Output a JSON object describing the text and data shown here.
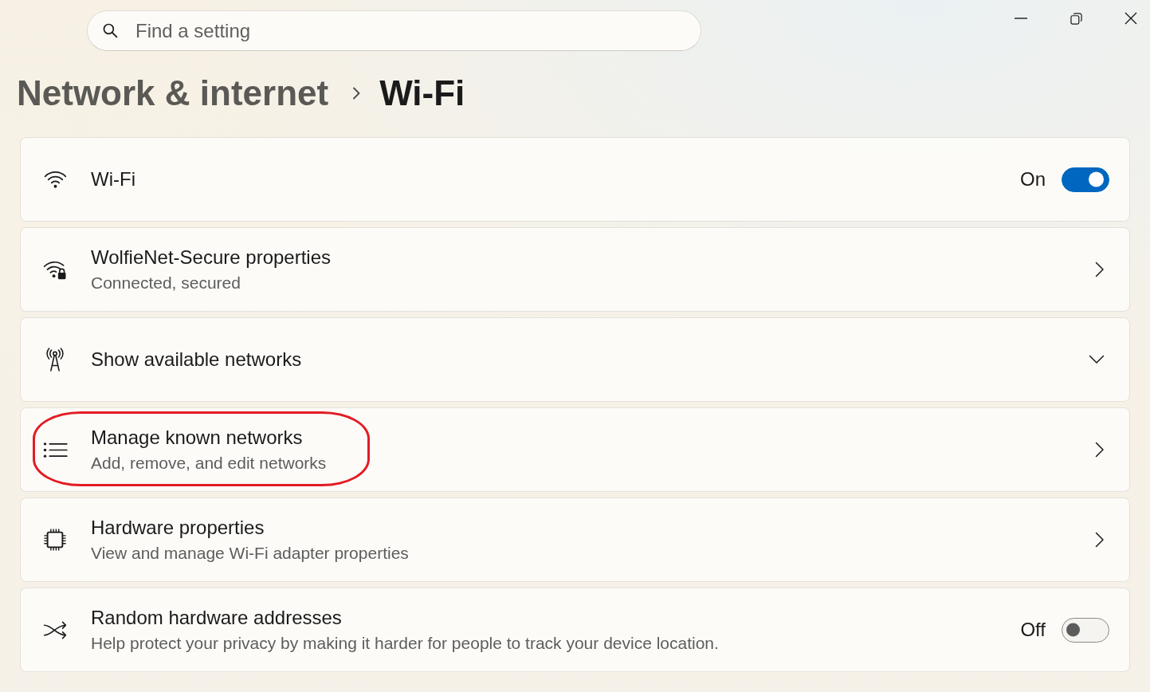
{
  "search": {
    "placeholder": "Find a setting"
  },
  "breadcrumb": {
    "parent": "Network & internet",
    "current": "Wi-Fi"
  },
  "settings": [
    {
      "kind": "toggle",
      "title": "Wi-Fi",
      "state_label": "On",
      "on": true,
      "highlighted": false
    },
    {
      "kind": "link",
      "title": "WolfieNet-Secure properties",
      "description": "Connected, secured",
      "highlighted": false
    },
    {
      "kind": "expander",
      "title": "Show available networks",
      "expanded": false,
      "highlighted": false
    },
    {
      "kind": "link",
      "title": "Manage known networks",
      "description": "Add, remove, and edit networks",
      "highlighted": true
    },
    {
      "kind": "link",
      "title": "Hardware properties",
      "description": "View and manage Wi-Fi adapter properties",
      "highlighted": false
    },
    {
      "kind": "toggle",
      "title": "Random hardware addresses",
      "description": "Help protect your privacy by making it harder for people to track your device location.",
      "state_label": "Off",
      "on": false,
      "highlighted": false
    }
  ]
}
